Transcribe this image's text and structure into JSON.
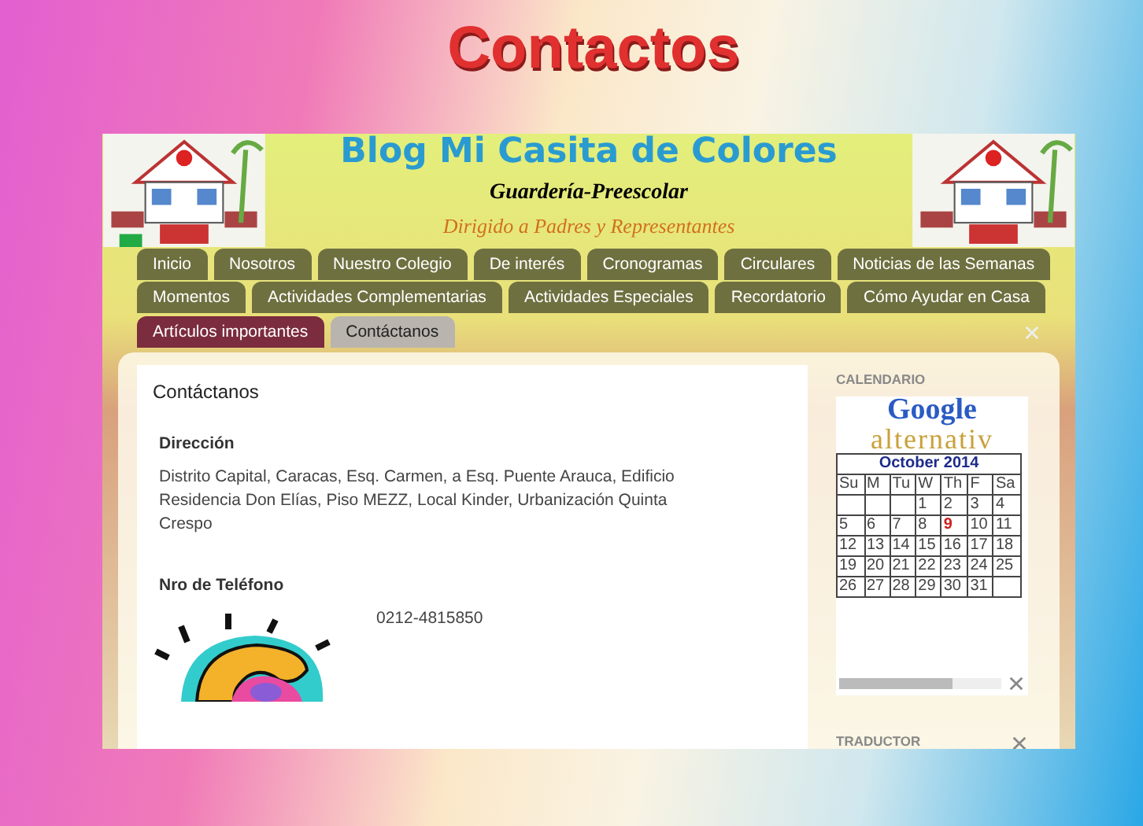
{
  "slide_title": "Contactos",
  "blog": {
    "title": "Blog Mi Casita de Colores",
    "subtitle": "Guardería-Preescolar",
    "tagline": "Dirigido a Padres y Representantes",
    "tab_rows": [
      [
        {
          "label": "Inicio",
          "selected": false
        },
        {
          "label": "Nosotros",
          "selected": false
        },
        {
          "label": "Nuestro Colegio",
          "selected": false
        },
        {
          "label": "De interés",
          "selected": false
        },
        {
          "label": "Cronogramas",
          "selected": false
        },
        {
          "label": "Circulares",
          "selected": false
        },
        {
          "label": "Noticias de las Semanas",
          "selected": false
        }
      ],
      [
        {
          "label": "Momentos",
          "selected": false
        },
        {
          "label": "Actividades Complementarias",
          "selected": false
        },
        {
          "label": "Actividades Especiales",
          "selected": false
        },
        {
          "label": "Recordatorio",
          "selected": false
        },
        {
          "label": "Cómo Ayudar en Casa",
          "selected": false
        }
      ],
      [
        {
          "label": "Artículos importantes",
          "selected": false
        },
        {
          "label": "Contáctanos",
          "selected": true
        }
      ]
    ],
    "post": {
      "title": "Contáctanos",
      "sections": [
        {
          "heading": "Dirección",
          "text": "Distrito Capital, Caracas, Esq. Carmen, a Esq. Puente Arauca, Edificio Residencia Don Elías, Piso MEZZ, Local Kinder, Urbanización Quinta Crespo"
        },
        {
          "heading": "Nro de Teléfono",
          "text": "0212-4815850"
        }
      ]
    },
    "sidebar": {
      "calendar_heading": "CALENDARIO",
      "logo_top": "Google",
      "logo_bottom": "alternativ",
      "calendar": {
        "month": "October 2014",
        "weekdays": [
          "Su",
          "M",
          "Tu",
          "W",
          "Th",
          "F",
          "Sa"
        ],
        "weeks": [
          [
            {
              "kind": "blank"
            },
            {
              "kind": "blank"
            },
            {
              "kind": "blank"
            },
            {
              "day": "1",
              "today": false
            },
            {
              "day": "2",
              "today": false
            },
            {
              "day": "3",
              "today": false
            },
            {
              "day": "4",
              "today": false
            }
          ],
          [
            {
              "day": "5",
              "today": false
            },
            {
              "day": "6",
              "today": false
            },
            {
              "day": "7",
              "today": false
            },
            {
              "day": "8",
              "today": false
            },
            {
              "day": "9",
              "today": true
            },
            {
              "day": "10",
              "today": false
            },
            {
              "day": "11",
              "today": false
            }
          ],
          [
            {
              "day": "12",
              "today": false
            },
            {
              "day": "13",
              "today": false
            },
            {
              "day": "14",
              "today": false
            },
            {
              "day": "15",
              "today": false
            },
            {
              "day": "16",
              "today": false
            },
            {
              "day": "17",
              "today": false
            },
            {
              "day": "18",
              "today": false
            }
          ],
          [
            {
              "day": "19",
              "today": false
            },
            {
              "day": "20",
              "today": false
            },
            {
              "day": "21",
              "today": false
            },
            {
              "day": "22",
              "today": false
            },
            {
              "day": "23",
              "today": false
            },
            {
              "day": "24",
              "today": false
            },
            {
              "day": "25",
              "today": false
            }
          ],
          [
            {
              "day": "26",
              "today": false
            },
            {
              "day": "27",
              "today": false
            },
            {
              "day": "28",
              "today": false
            },
            {
              "day": "29",
              "today": false
            },
            {
              "day": "30",
              "today": false
            },
            {
              "day": "31",
              "today": false
            },
            {
              "kind": "blank"
            }
          ]
        ]
      },
      "translator_heading": "TRADUCTOR"
    }
  }
}
